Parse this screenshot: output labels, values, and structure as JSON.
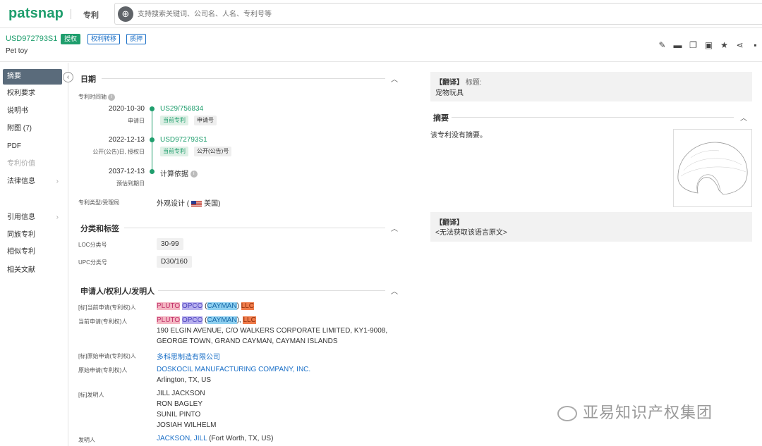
{
  "topbar": {
    "logo": "patsnap",
    "category": "专利",
    "search_placeholder": "支持搜索关键词、公司名、人名、专利号等"
  },
  "header": {
    "patent_no": "USD972793S1",
    "tags": [
      "授权",
      "权利转移",
      "质押"
    ],
    "title": "Pet toy"
  },
  "sidebar": {
    "items": [
      {
        "label": "摘要"
      },
      {
        "label": "权利要求"
      },
      {
        "label": "说明书"
      },
      {
        "label": "附图 (7)"
      },
      {
        "label": "PDF"
      },
      {
        "label": "专利价值"
      },
      {
        "label": "法律信息"
      },
      {
        "label": "引用信息"
      },
      {
        "label": "同族专利"
      },
      {
        "label": "相似专利"
      },
      {
        "label": "相关文献"
      }
    ]
  },
  "dates": {
    "section": "日期",
    "timeline_label": "专利时间轴",
    "entries": [
      {
        "date": "2020-10-30",
        "sub": "申请日",
        "number": "US29/756834",
        "chips": [
          "当前专利",
          "申请号"
        ]
      },
      {
        "date": "2022-12-13",
        "sub": "公开(公告)日, 授权日",
        "number": "USD972793S1",
        "chips": [
          "当前专利",
          "公开(公告)号"
        ]
      },
      {
        "date": "2037-12-13",
        "sub": "预估到期日",
        "number": "计算依据",
        "chips": []
      }
    ],
    "type_label": "专利类型/受理局",
    "type_value": "外观设计 (",
    "country": "美国)"
  },
  "classification": {
    "section": "分类和标签",
    "loc_label": "LOC分类号",
    "loc": "30-99",
    "upc_label": "UPC分类号",
    "upc": "D30/160"
  },
  "parties": {
    "section": "申请人/权利人/发明人",
    "rows": [
      {
        "label": "[标]当前申请(专利权)人"
      },
      {
        "label": "当前申请(专利权)人",
        "addr1": "190 ELGIN AVENUE, C/O WALKERS CORPORATE LIMITED, KY1-9008,",
        "addr2": "GEORGE TOWN, GRAND CAYMAN, CAYMAN ISLANDS"
      },
      {
        "label": "[标]原始申请(专利权)人",
        "value": "多科思制造有限公司"
      },
      {
        "label": "原始申请(专利权)人",
        "value": "DOSKOCIL MANUFACTURING COMPANY, INC.",
        "addr": "Arlington, TX, US"
      },
      {
        "label": "[标]发明人",
        "names": [
          "JILL JACKSON",
          "RON BAGLEY",
          "SUNIL PINTO",
          "JOSIAH WILHELM"
        ]
      },
      {
        "label": "发明人",
        "value": "JACKSON, JILL",
        "addr": "(Fort Worth, TX, US)"
      }
    ],
    "w1": "PLUTO",
    "w2": "OPCO",
    "w3": "CAYMAN",
    "w4": "LLC"
  },
  "right": {
    "trans_label": "【翻译】",
    "title_label": "标题:",
    "title_value": "宠物玩具",
    "abstract_heading": "摘要",
    "abstract_text": "该专利没有摘要。",
    "trans2_label": "【翻译】",
    "trans2_value": "<无法获取该语言原文>"
  },
  "watermark": "亚易知识产权集团"
}
